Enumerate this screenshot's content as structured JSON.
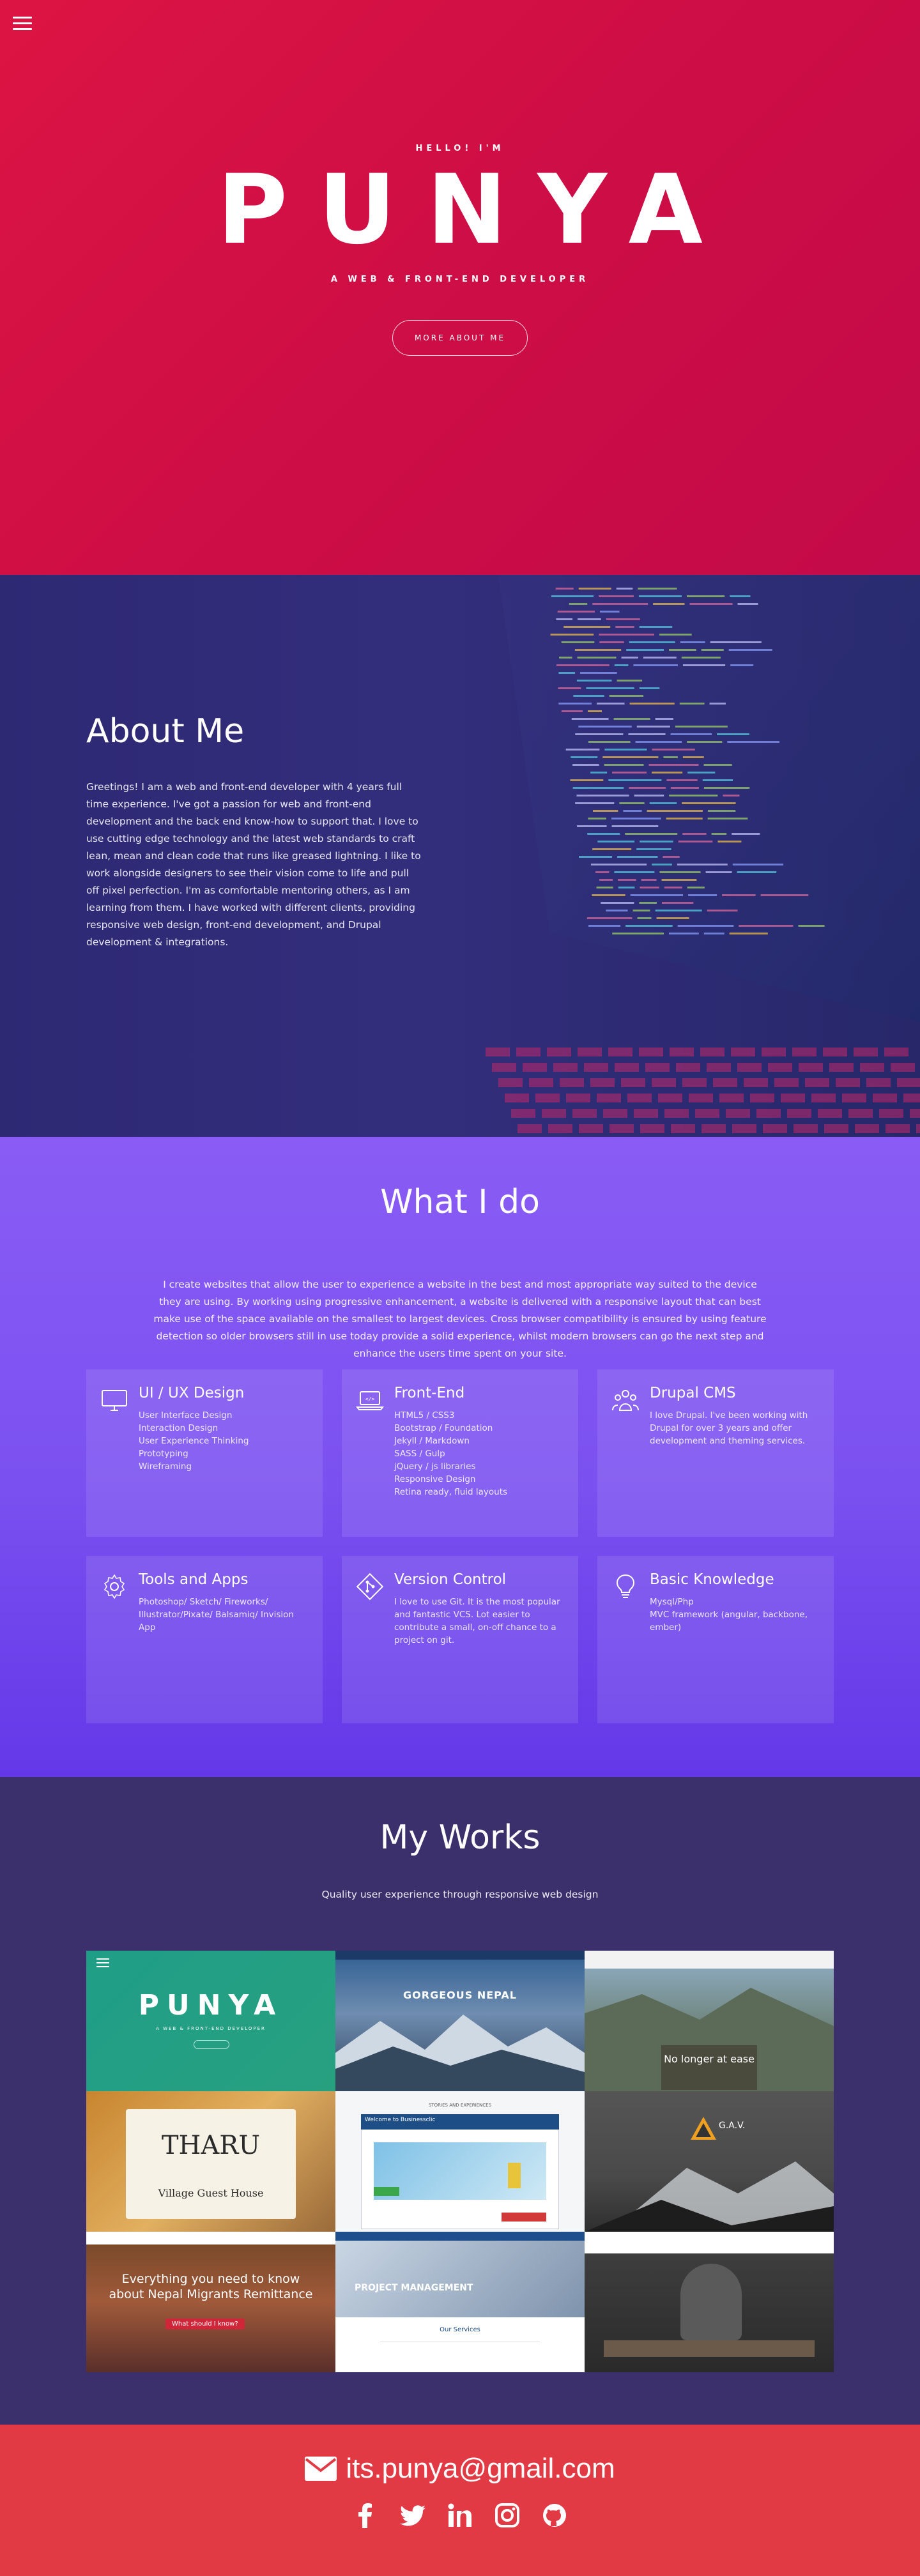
{
  "hero": {
    "menu_icon": "hamburger-icon",
    "greeting": "HELLO! I'M",
    "name": "PUNYA",
    "role": "A WEB & FRONT-END DEVELOPER",
    "button": "MORE ABOUT ME"
  },
  "about": {
    "title": "About Me",
    "body": "Greetings! I am a web and front-end developer with 4 years full time experience. I've got a passion for web and front-end development and the back end know-how to support that. I love to use cutting edge technology and the latest web standards to craft lean, mean and clean code that runs like greased lightning. I like to work alongside designers to see their vision come to life and pull off pixel perfection. I'm as comfortable mentoring others, as I am learning from them. I have worked with different clients, providing responsive web design, front-end development, and Drupal development & integrations."
  },
  "whatido": {
    "title": "What I do",
    "intro": "I create websites that allow the user to experience a website in the best and most appropriate way suited to the device they are using. By working using progressive enhancement, a website is delivered with a responsive layout that can best make use of the space available on the smallest to largest devices. Cross browser compatibility is ensured by using feature detection so older browsers still in use today provide a solid experience, whilst modern browsers can go the next step and enhance the users time spent on your site.",
    "cards": [
      {
        "icon": "monitor-icon",
        "title": "UI / UX Design",
        "items": [
          "User Interface Design",
          "Interaction Design",
          "User Experience Thinking",
          "Prototyping",
          "Wireframing"
        ]
      },
      {
        "icon": "laptop-code-icon",
        "title": "Front-End",
        "items": [
          "HTML5 / CSS3",
          "Bootstrap / Foundation",
          "Jekyll / Markdown",
          "SASS / Gulp",
          "jQuery / js libraries",
          "Responsive Design",
          "Retina ready, fluid layouts"
        ]
      },
      {
        "icon": "people-icon",
        "title": "Drupal CMS",
        "items": [
          "I love Drupal. I've been working with Drupal for over 3 years and offer development and theming services."
        ]
      },
      {
        "icon": "gear-icon",
        "title": "Tools and Apps",
        "items": [
          "Photoshop/ Sketch/ Fireworks/ Illustrator/Pixate/ Balsamiq/ Invision App"
        ]
      },
      {
        "icon": "git-icon",
        "title": "Version Control",
        "items": [
          "I love to use Git. It is the most popular and fantastic VCS. Lot easier to contribute a small, on-off chance to a project on git."
        ]
      },
      {
        "icon": "lightbulb-icon",
        "title": "Basic Knowledge",
        "items": [
          "Mysql/Php",
          "MVC framework (angular, backbone, ember)"
        ]
      }
    ]
  },
  "works": {
    "title": "My Works",
    "subtitle": "Quality user experience through responsive web design",
    "tiles": [
      {
        "caption": "PUNYA",
        "sub": "A WEB & FRONT-END DEVELOPER"
      },
      {
        "caption": "GORGEOUS NEPAL",
        "sub": "Gorgeous Nepal"
      },
      {
        "caption": "No longer at ease",
        "sub": ""
      },
      {
        "caption": "THARU",
        "sub": "Village Guest House"
      },
      {
        "caption": "STORIES AND EXPERIENCES",
        "sub": "Welcome to Businessclic"
      },
      {
        "caption": "G.A.V.",
        "sub": ""
      },
      {
        "caption": "Everything you need to know about Nepal Migrants Remittance",
        "sub": "What should I know?"
      },
      {
        "caption": "PROJECT MANAGEMENT",
        "sub": "Our Services"
      },
      {
        "caption": "",
        "sub": ""
      }
    ]
  },
  "footer": {
    "email_icon": "envelope-icon",
    "email": "its.punya@gmail.com",
    "socials": [
      "facebook-icon",
      "twitter-icon",
      "linkedin-icon",
      "instagram-icon",
      "github-icon"
    ]
  },
  "colors": {
    "hero": "#d3123f",
    "about": "#302b76",
    "whatido": "#7a50f0",
    "works": "#3b2f6c",
    "footer": "#e23a45"
  }
}
